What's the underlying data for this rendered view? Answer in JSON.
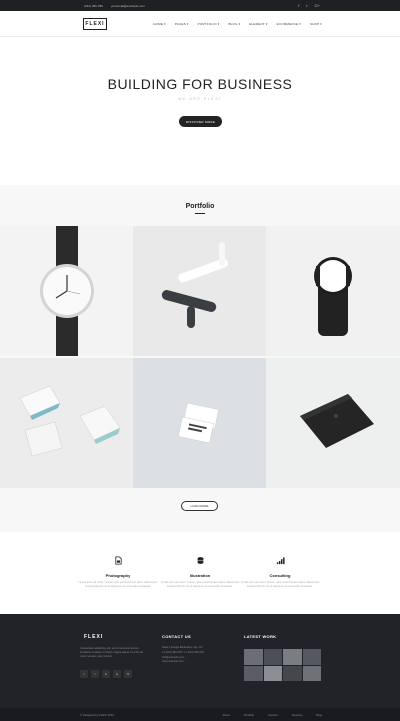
{
  "topbar": {
    "phone": "(012) 456-789",
    "email": "youremail@example.com",
    "social": [
      "f",
      "t",
      "G+"
    ]
  },
  "nav": {
    "logo": "FLEXI",
    "items": [
      "HOME ▾",
      "PAGES ▾",
      "PORTFOLIO ▾",
      "BLOG ▾",
      "ELEMENT ▾",
      "ECOMMERCE ▾",
      "SHOP ▾"
    ]
  },
  "hero": {
    "title": "BUILDING FOR BUSINESS",
    "subtitle": "WE ARE FLEXI",
    "button": "DISCOVER MORE"
  },
  "portfolio": {
    "title": "Portfolio",
    "load_more": "LOAD MORE"
  },
  "services": [
    {
      "title": "Photography",
      "desc": "Ut wisi enim ad minim veniam, quis nostrud exerci tation ullamcorper suscipit lobortis nisl ut aliquip ex ea commodo consequat."
    },
    {
      "title": "Illustration",
      "desc": "Ut wisi enim ad minim veniam, quis nostrud exerci tation ullamcorper suscipit lobortis nisl ut aliquip ex ea commodo consequat."
    },
    {
      "title": "Consulting",
      "desc": "Ut wisi enim ad minim veniam, quis nostrud exerci tation ullamcorper suscipit lobortis nisl ut aliquip ex ea commodo consequat."
    }
  ],
  "footer": {
    "logo": "FLEXI",
    "about": "Consectetur adipiscing elit, sed do eiusmod tempor incididunt ut labore et dolore magna aliqua. Ut enim ad minim veniam, quis nostrud.",
    "social": [
      "f",
      "t",
      "in",
      "G",
      "✉"
    ],
    "contact_title": "CONTACT US",
    "contact_lines": [
      "Suite 1 Google Boulevard, City, CA",
      "+1 (012) 345 678 / +1 (012) 345 678",
      "info@example.com",
      "www.example.com"
    ],
    "work_title": "LATEST WORK"
  },
  "bottom": {
    "copyright": "© Designed by FLEXI 2016. ",
    "links": [
      "About",
      "Portfolio",
      "Contact",
      "Services",
      "Blog"
    ]
  },
  "colors": {
    "dark": "#222328",
    "accent": "#222222"
  }
}
